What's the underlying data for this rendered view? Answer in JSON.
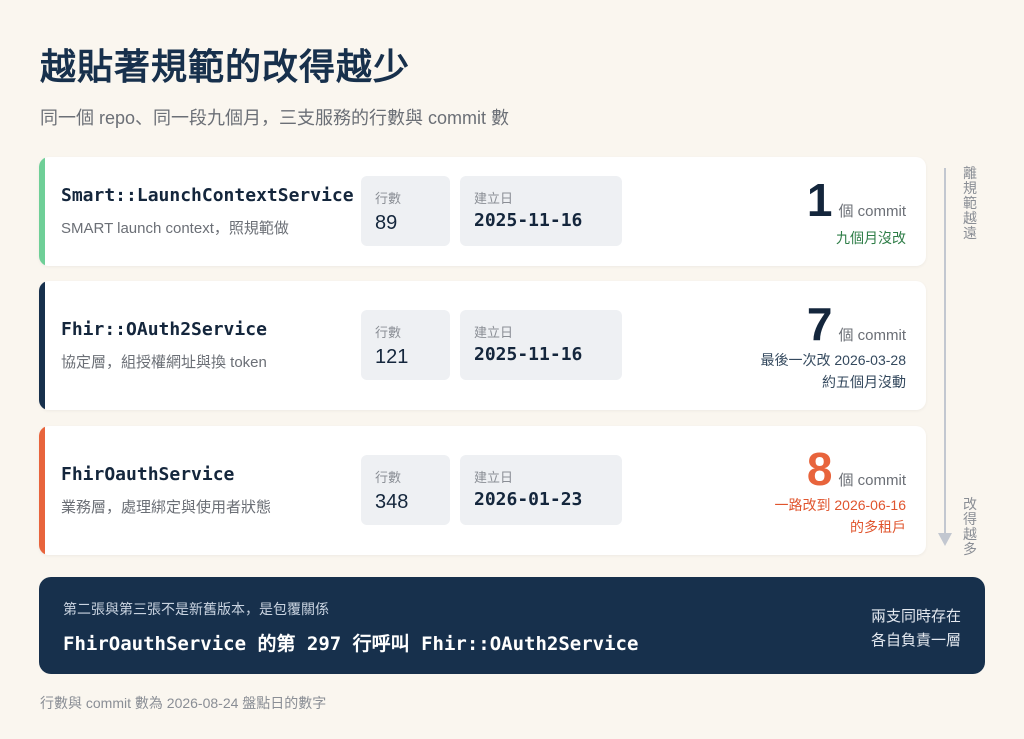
{
  "title": "越貼著規範的改得越少",
  "subtitle": "同一個 repo、同一段九個月，三支服務的行數與 commit 數",
  "axis": {
    "top_label": "離規範越遠",
    "bottom_label": "改得越多"
  },
  "field_labels": {
    "lines": "行數",
    "created": "建立日",
    "commit_unit": "個 commit"
  },
  "cards": [
    {
      "name": "Smart::LaunchContextService",
      "desc": "SMART launch context，照規範做",
      "lines": "89",
      "created": "2025-11-16",
      "commits": "1",
      "note1": "九個月沒改",
      "note2": "",
      "accent": "#6fcf97",
      "note_color": "#2e7d47",
      "num_color": "#14263c"
    },
    {
      "name": "Fhir::OAuth2Service",
      "desc": "協定層，組授權網址與換 token",
      "lines": "121",
      "created": "2025-11-16",
      "commits": "7",
      "note1": "最後一次改 2026-03-28",
      "note2": "約五個月沒動",
      "accent": "#17304c",
      "note_color": "#34495e",
      "num_color": "#14263c"
    },
    {
      "name": "FhirOauthService",
      "desc": "業務層，處理綁定與使用者狀態",
      "lines": "348",
      "created": "2026-01-23",
      "commits": "8",
      "note1": "一路改到 2026-06-16",
      "note2": "的多租戶",
      "accent": "#e8643c",
      "note_color": "#e0552e",
      "num_color": "#e8643c"
    }
  ],
  "banner": {
    "small": "第二張與第三張不是新舊版本，是包覆關係",
    "main": "FhirOauthService 的第 297 行呼叫 Fhir::OAuth2Service",
    "right1": "兩支同時存在",
    "right2": "各自負責一層"
  },
  "footer": "行數與 commit 數為 2026-08-24 盤點日的數字"
}
